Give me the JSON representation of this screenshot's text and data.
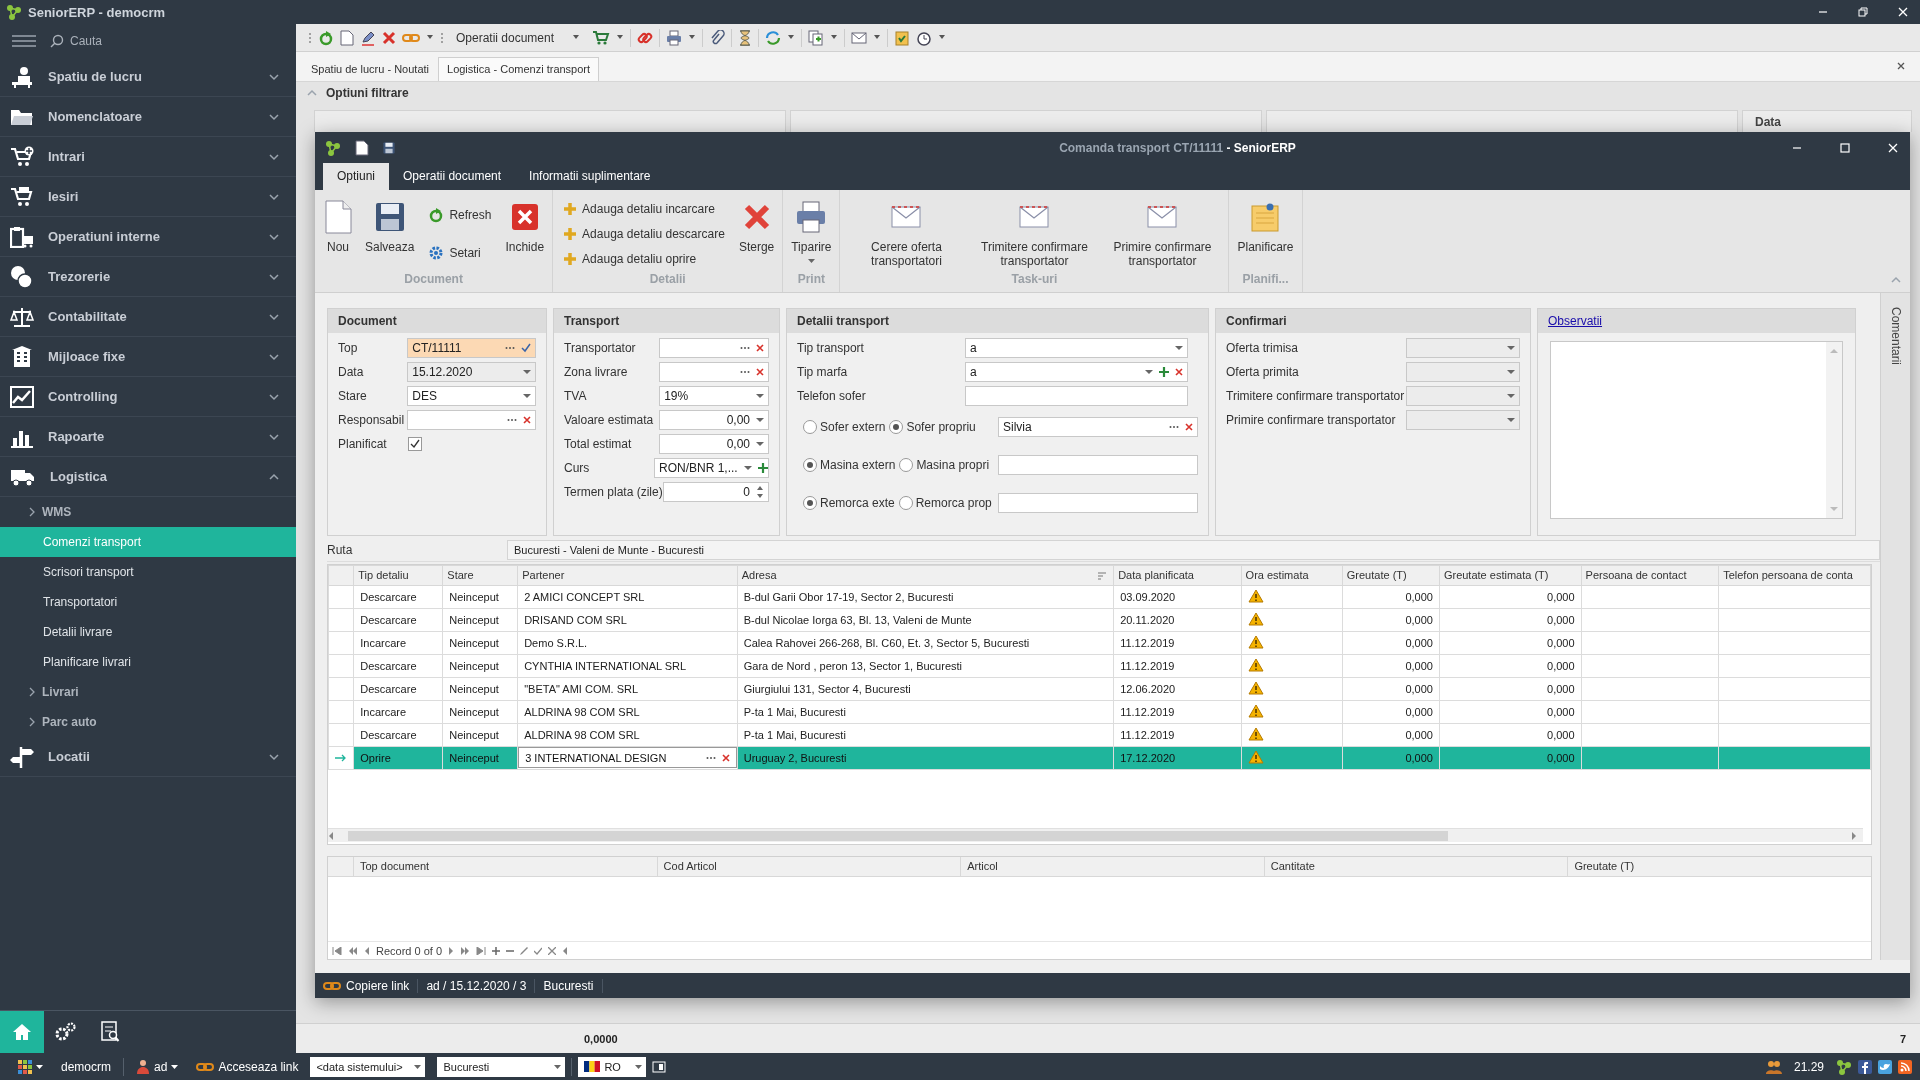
{
  "app": {
    "title": "SeniorERP - democrm",
    "search_placeholder": "Cauta"
  },
  "sidebar": {
    "items": [
      {
        "label": "Spatiu de lucru",
        "expanded": false
      },
      {
        "label": "Nomenclatoare",
        "expanded": false
      },
      {
        "label": "Intrari",
        "expanded": false
      },
      {
        "label": "Iesiri",
        "expanded": false
      },
      {
        "label": "Operatiuni interne",
        "expanded": false
      },
      {
        "label": "Trezorerie",
        "expanded": false
      },
      {
        "label": "Contabilitate",
        "expanded": false
      },
      {
        "label": "Mijloace fixe",
        "expanded": false
      },
      {
        "label": "Controlling",
        "expanded": false
      },
      {
        "label": "Rapoarte",
        "expanded": false
      },
      {
        "label": "Logistica",
        "expanded": true,
        "children": [
          {
            "label": "WMS",
            "kind": "group",
            "expanded": false
          },
          {
            "label": "Comenzi transport",
            "kind": "item",
            "selected": true
          },
          {
            "label": "Scrisori transport",
            "kind": "item",
            "selected": false
          },
          {
            "label": "Transportatori",
            "kind": "item",
            "selected": false
          },
          {
            "label": "Detalii livrare",
            "kind": "item",
            "selected": false
          },
          {
            "label": "Planificare livrari",
            "kind": "item",
            "selected": false
          },
          {
            "label": "Livrari",
            "kind": "group",
            "expanded": false
          },
          {
            "label": "Parc auto",
            "kind": "group",
            "expanded": false
          }
        ]
      },
      {
        "label": "Locatii",
        "expanded": false
      }
    ],
    "quick_buttons": [
      {
        "selected": true
      },
      {
        "selected": false
      },
      {
        "selected": false
      }
    ]
  },
  "toolbar": {
    "menu_label": "Operatii document"
  },
  "document_tabs": [
    {
      "label": "Spatiu de lucru - Noutati",
      "selected": false
    },
    {
      "label": "Logistica - Comenzi transport",
      "selected": true
    }
  ],
  "filter": {
    "title": "Optiuni filtrare",
    "expanded": true,
    "visible_column": "Data"
  },
  "summary": {
    "total": "0,0000",
    "count": "7"
  },
  "window": {
    "title": "Comanda transport CT/11111",
    "app": "- SeniorERP",
    "ribbon": {
      "tabs": [
        {
          "label": "Optiuni",
          "selected": true
        },
        {
          "label": "Operatii document",
          "selected": false
        },
        {
          "label": "Informatii suplimentare",
          "selected": false
        }
      ],
      "groups": [
        {
          "label": "Document",
          "items": [
            {
              "kind": "large",
              "label": "Nou",
              "dropdown": false
            },
            {
              "kind": "large",
              "label": "Salveaza",
              "dropdown": false
            },
            {
              "kind": "stack",
              "items": [
                {
                  "label": "Refresh"
                },
                {
                  "label": "Setari"
                }
              ]
            },
            {
              "kind": "large",
              "label": "Inchide",
              "dropdown": false
            }
          ]
        },
        {
          "label": "Detalii",
          "items": [
            {
              "kind": "stack",
              "items": [
                {
                  "label": "Adauga detaliu incarcare"
                },
                {
                  "label": "Adauga detaliu descarcare"
                },
                {
                  "label": "Adauga detaliu oprire"
                }
              ]
            },
            {
              "kind": "large",
              "label": "Sterge",
              "dropdown": false
            }
          ]
        },
        {
          "label": "Print",
          "items": [
            {
              "kind": "large",
              "label": "Tiparire",
              "dropdown": true
            }
          ]
        },
        {
          "label": "Task-uri",
          "items": [
            {
              "kind": "large",
              "label": "Cerere oferta transportatori",
              "dropdown": false
            },
            {
              "kind": "large",
              "label": "Trimitere confirmare transportator",
              "dropdown": false
            },
            {
              "kind": "large",
              "label": "Primire confirmare transportator",
              "dropdown": false
            }
          ]
        },
        {
          "label": "Planifi...",
          "items": [
            {
              "kind": "large",
              "label": "Planificare",
              "dropdown": false
            }
          ]
        }
      ]
    },
    "panels": [
      {
        "title": "Document",
        "rows": [
          {
            "kind": "lookup",
            "label": "Top",
            "value": "CT/11111",
            "highlighted": true,
            "confirmed": true
          },
          {
            "kind": "dropdown",
            "label": "Data",
            "value": "15.12.2020",
            "disabled": true
          },
          {
            "kind": "dropdown",
            "label": "Stare",
            "value": "DES"
          },
          {
            "kind": "lookup",
            "label": "Responsabil",
            "clearable": true
          },
          {
            "kind": "check",
            "label": "Planificat",
            "checked": true
          }
        ]
      },
      {
        "title": "Transport",
        "rows": [
          {
            "kind": "lookup",
            "label": "Transportator",
            "clearable": true
          },
          {
            "kind": "lookup",
            "label": "Zona livrare",
            "clearable": true
          },
          {
            "kind": "dropdown",
            "label": "TVA",
            "value": "19%"
          },
          {
            "kind": "dropdown",
            "label": "Valoare estimata",
            "value": "0,00",
            "numeric": true
          },
          {
            "kind": "dropdown",
            "label": "Total estimat",
            "value": "0,00",
            "numeric": true
          },
          {
            "kind": "dropdown",
            "label": "Curs",
            "value": "RON/BNR 1,...",
            "addable": true
          },
          {
            "kind": "spin",
            "label": "Termen plata (zile)",
            "value": "0",
            "numeric": true
          }
        ]
      },
      {
        "title": "Detalii transport",
        "rows": [
          {
            "kind": "dropdown",
            "label": "Tip transport",
            "value": "a"
          },
          {
            "kind": "dropdown",
            "label": "Tip marfa",
            "value": "a",
            "addable": true,
            "clearable": true
          },
          {
            "kind": "text",
            "label": "Telefon sofer"
          },
          {
            "kind": "radio",
            "options": [
              {
                "label": "Sofer extern",
                "selected": false
              },
              {
                "label": "Sofer propriu",
                "selected": true
              }
            ],
            "field": {
              "kind": "lookup",
              "value": "Silvia",
              "clearable": true
            }
          },
          {
            "kind": "radio",
            "options": [
              {
                "label": "Masina extern",
                "selected": true
              },
              {
                "label": "Masina propri",
                "selected": false
              }
            ],
            "field": {
              "kind": "text"
            }
          },
          {
            "kind": "radio",
            "options": [
              {
                "label": "Remorca exte",
                "selected": true
              },
              {
                "label": "Remorca prop",
                "selected": false
              }
            ],
            "field": {
              "kind": "text"
            }
          }
        ]
      },
      {
        "title": "Confirmari",
        "rows": [
          {
            "kind": "dropdown",
            "label": "Oferta trimisa",
            "disabled": true
          },
          {
            "kind": "dropdown",
            "label": "Oferta primita",
            "disabled": true
          },
          {
            "kind": "dropdown",
            "label": "Trimitere confirmare transportator",
            "disabled": true
          },
          {
            "kind": "dropdown",
            "label": "Primire confirmare transportator",
            "disabled": true
          }
        ]
      }
    ],
    "notes": {
      "link": "Observatii"
    },
    "side_tab": "Comentarii",
    "route": {
      "label": "Ruta",
      "value": "Bucuresti - Valeni de Munte - Bucuresti"
    },
    "grid": {
      "columns": [
        "Tip detaliu",
        "Stare",
        "Partener",
        "Adresa",
        "Data planificata",
        "Ora estimata",
        "Greutate (T)",
        "Greutate estimata (T)",
        "Persoana de contact",
        "Telefon persoana de conta"
      ],
      "rows": [
        {
          "tip": "Descarcare",
          "stare": "Neinceput",
          "partener": "2 AMICI CONCEPT SRL",
          "adresa": "B-dul Garii Obor 17-19, Sector 2, Bucuresti",
          "data": "03.09.2020",
          "warning": true,
          "greutate": "0,000",
          "greutate_estimata": "0,000",
          "selected": false,
          "editing": false
        },
        {
          "tip": "Descarcare",
          "stare": "Neinceput",
          "partener": "DRISAND COM SRL",
          "adresa": "B-dul Nicolae Iorga 63, Bl. 13, Valeni de Munte",
          "data": "20.11.2020",
          "warning": true,
          "greutate": "0,000",
          "greutate_estimata": "0,000",
          "selected": false,
          "editing": false
        },
        {
          "tip": "Incarcare",
          "stare": "Neinceput",
          "partener": "Demo S.R.L.",
          "adresa": "Calea Rahovei 266-268, Bl. C60, Et. 3, Sector 5, Bucuresti",
          "data": "11.12.2019",
          "warning": true,
          "greutate": "0,000",
          "greutate_estimata": "0,000",
          "selected": false,
          "editing": false
        },
        {
          "tip": "Descarcare",
          "stare": "Neinceput",
          "partener": "CYNTHIA INTERNATIONAL SRL",
          "adresa": "Gara de Nord , peron 13, Sector 1, Bucuresti",
          "data": "11.12.2019",
          "warning": true,
          "greutate": "0,000",
          "greutate_estimata": "0,000",
          "selected": false,
          "editing": false
        },
        {
          "tip": "Descarcare",
          "stare": "Neinceput",
          "partener": "\"BETA\" AMI COM. SRL",
          "adresa": "Giurgiului 131, Sector 4, Bucuresti",
          "data": "12.06.2020",
          "warning": true,
          "greutate": "0,000",
          "greutate_estimata": "0,000",
          "selected": false,
          "editing": false
        },
        {
          "tip": "Incarcare",
          "stare": "Neinceput",
          "partener": "ALDRINA 98 COM SRL",
          "adresa": "P-ta 1 Mai, Bucuresti",
          "data": "11.12.2019",
          "warning": true,
          "greutate": "0,000",
          "greutate_estimata": "0,000",
          "selected": false,
          "editing": false
        },
        {
          "tip": "Descarcare",
          "stare": "Neinceput",
          "partener": "ALDRINA 98 COM SRL",
          "adresa": "P-ta 1 Mai, Bucuresti",
          "data": "11.12.2019",
          "warning": true,
          "greutate": "0,000",
          "greutate_estimata": "0,000",
          "selected": false,
          "editing": false
        },
        {
          "tip": "Oprire",
          "stare": "Neinceput",
          "partener": "3 INTERNATIONAL DESIGN",
          "adresa": "Uruguay 2, Bucuresti",
          "data": "17.12.2020",
          "warning": true,
          "greutate": "0,000",
          "greutate_estimata": "0,000",
          "selected": true,
          "editing": true
        }
      ]
    },
    "detail_grid": {
      "columns": [
        "Top document",
        "Cod Articol",
        "Articol",
        "Cantitate",
        "Greutate (T)"
      ],
      "record": "Record 0 of 0"
    },
    "status_bar": {
      "link": "Copiere link",
      "info": "ad / 15.12.2020 / 3",
      "location": "Bucuresti"
    }
  },
  "taskbar": {
    "database": "democrm",
    "user": "ad",
    "link": "Acceseaza link",
    "date_selector": "<data sistemului>",
    "location_selector": "Bucuresti",
    "language": "RO",
    "clock": "21.29"
  }
}
